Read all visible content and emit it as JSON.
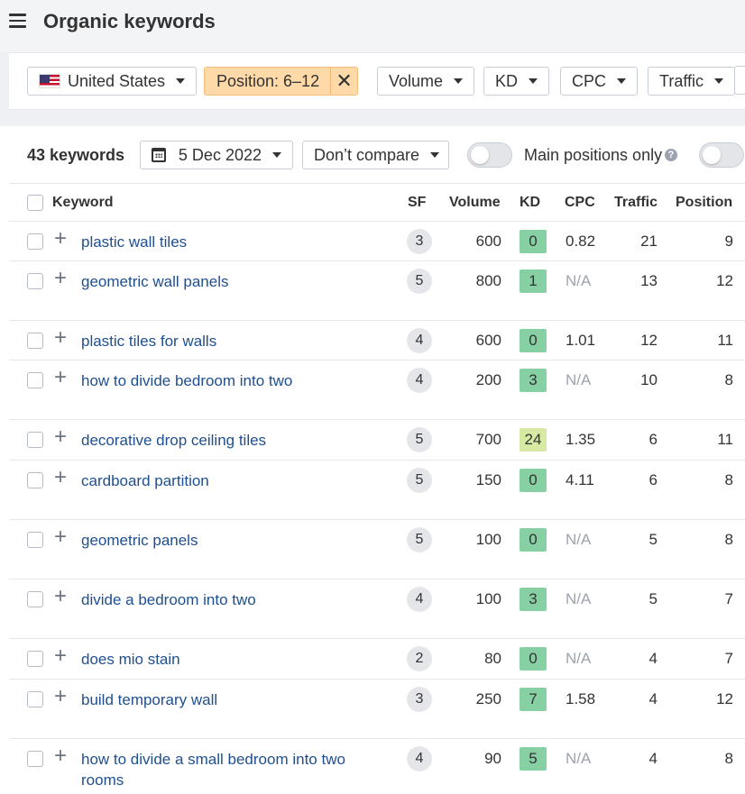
{
  "header": {
    "title": "Organic keywords"
  },
  "filters": {
    "country": "United States",
    "position": "Position: 6–12",
    "volume": "Volume",
    "kd": "KD",
    "cpc": "CPC",
    "traffic": "Traffic"
  },
  "toolbar": {
    "keyword_count": "43 keywords",
    "date": "5 Dec 2022",
    "compare": "Don’t compare",
    "main_positions_label": "Main positions only",
    "help": "?"
  },
  "table": {
    "columns": {
      "keyword": "Keyword",
      "sf": "SF",
      "volume": "Volume",
      "kd": "KD",
      "cpc": "CPC",
      "traffic": "Traffic",
      "position": "Position"
    },
    "rows": [
      {
        "keyword": "plastic wall tiles",
        "sf": "3",
        "volume": "600",
        "kd": "0",
        "cpc": "0.82",
        "traffic": "21",
        "position": "9"
      },
      {
        "keyword": "geometric wall panels",
        "sf": "5",
        "volume": "800",
        "kd": "1",
        "cpc": "N/A",
        "traffic": "13",
        "position": "12"
      },
      {
        "keyword": "plastic tiles for walls",
        "sf": "4",
        "volume": "600",
        "kd": "0",
        "cpc": "1.01",
        "traffic": "12",
        "position": "11"
      },
      {
        "keyword": "how to divide bedroom into two",
        "sf": "4",
        "volume": "200",
        "kd": "3",
        "cpc": "N/A",
        "traffic": "10",
        "position": "8"
      },
      {
        "keyword": "decorative drop ceiling tiles",
        "sf": "5",
        "volume": "700",
        "kd": "24",
        "cpc": "1.35",
        "traffic": "6",
        "position": "11"
      },
      {
        "keyword": "cardboard partition",
        "sf": "5",
        "volume": "150",
        "kd": "0",
        "cpc": "4.11",
        "traffic": "6",
        "position": "8"
      },
      {
        "keyword": "geometric panels",
        "sf": "5",
        "volume": "100",
        "kd": "0",
        "cpc": "N/A",
        "traffic": "5",
        "position": "8"
      },
      {
        "keyword": "divide a bedroom into two",
        "sf": "4",
        "volume": "100",
        "kd": "3",
        "cpc": "N/A",
        "traffic": "5",
        "position": "7"
      },
      {
        "keyword": "does mio stain",
        "sf": "2",
        "volume": "80",
        "kd": "0",
        "cpc": "N/A",
        "traffic": "4",
        "position": "7"
      },
      {
        "keyword": "build temporary wall",
        "sf": "3",
        "volume": "250",
        "kd": "7",
        "cpc": "1.58",
        "traffic": "4",
        "position": "12"
      },
      {
        "keyword": "how to divide a small bedroom into two rooms",
        "sf": "4",
        "volume": "90",
        "kd": "5",
        "cpc": "N/A",
        "traffic": "4",
        "position": "8"
      }
    ]
  },
  "colors": {
    "kd_easy": "#86d0a4",
    "kd_medium": "#d6eaa4",
    "link": "#1f4f8f",
    "active_filter": "#ffd9a8"
  }
}
